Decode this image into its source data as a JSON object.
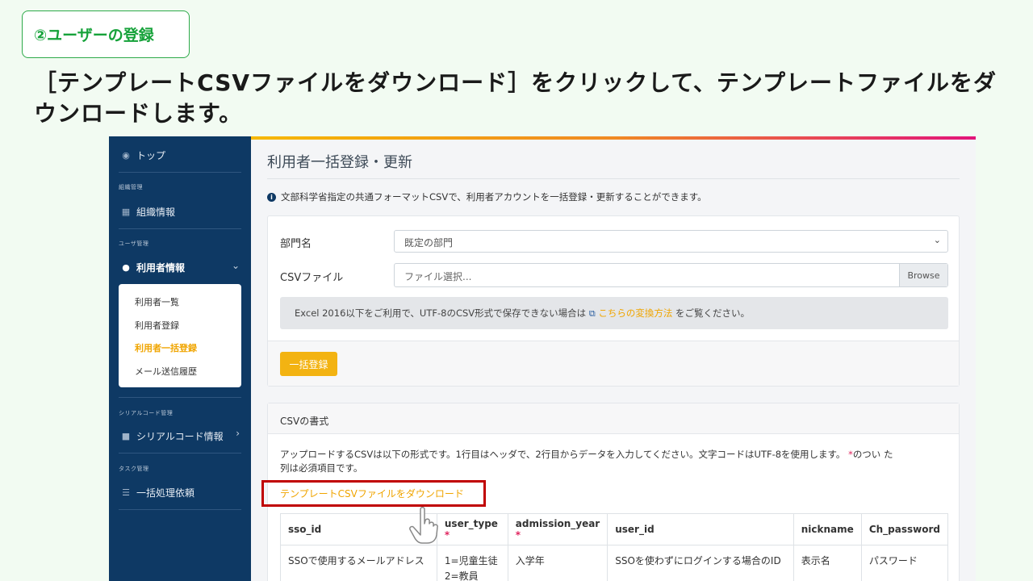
{
  "step_label": "②ユーザーの登録",
  "instruction": "［テンプレートCSVファイルをダウンロード］をクリックして、テンプレートファイルをダウンロードします。",
  "sidebar": {
    "top": "トップ",
    "section_org": "組織管理",
    "org_info": "組織情報",
    "section_user": "ユーザ管理",
    "user_info": "利用者情報",
    "sub_items": [
      "利用者一覧",
      "利用者登録",
      "利用者一括登録",
      "メール送信履歴"
    ],
    "section_serial": "シリアルコード管理",
    "serial_info": "シリアルコード情報",
    "section_task": "タスク管理",
    "batch_request": "一括処理依頼"
  },
  "main": {
    "title": "利用者一括登録・更新",
    "info": "文部科学省指定の共通フォーマットCSVで、利用者アカウントを一括登録・更新することができます。",
    "department_label": "部門名",
    "department_value": "既定の部門",
    "csv_label": "CSVファイル",
    "file_placeholder": "ファイル選択...",
    "browse": "Browse",
    "note_pre": "Excel 2016以下をご利用で、UTF-8のCSV形式で保存できない場合は",
    "note_link": "こちらの変換方法",
    "note_post": "をご覧ください。",
    "bulk_button": "一括登録",
    "format_header": "CSVの書式",
    "format_desc_main": "アップロードするCSVは以下の形式です。1行目はヘッダで、2行目からデータを入力してください。文字コードはUTF-8を使用します。",
    "format_desc_star": "*",
    "format_desc_tail1": "のつい た",
    "format_desc_tail2": "列は必須項目です。",
    "download_link": "テンプレートCSVファイルをダウンロード",
    "table": {
      "headers": [
        "sso_id",
        "user_type",
        "admission_year",
        "user_id",
        "nickname",
        "Ch_password"
      ],
      "required": [
        "",
        "*",
        "*",
        "",
        "",
        ""
      ],
      "row": [
        "SSOで使用するメールアドレス",
        "1=児童生徒",
        "入学年",
        "SSOを使わずにログインする場合のID",
        "表示名",
        "パスワード"
      ],
      "row_extra": "2=教員"
    }
  },
  "colors": {
    "accent": "#f0a500",
    "sidebar": "#0e3964",
    "highlight": "#c00000",
    "step": "#16a23a"
  }
}
